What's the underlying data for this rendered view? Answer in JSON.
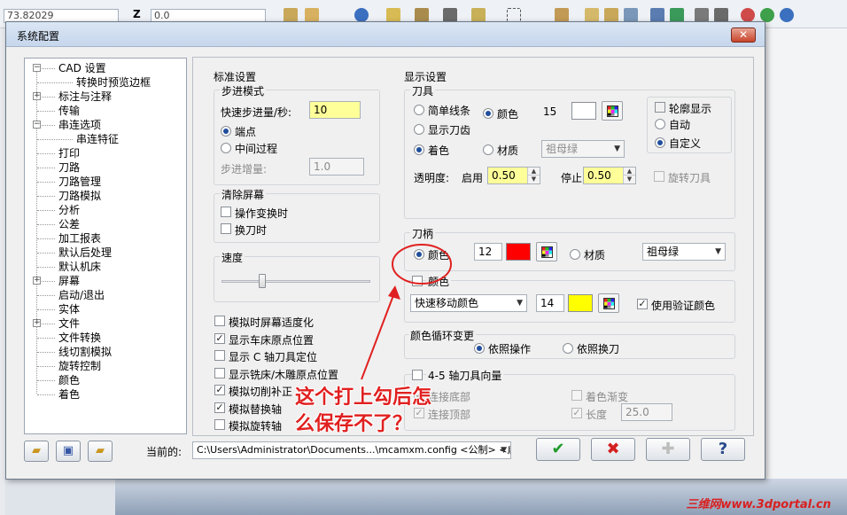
{
  "bg_toolbar": {
    "coord_value": "73.82029",
    "z_label": "Z",
    "z_value": "0.0"
  },
  "watermark": "三维网www.3dportal.cn",
  "dialog": {
    "title": "系统配置",
    "close_label": "✕"
  },
  "tree": {
    "items": [
      {
        "label": "CAD 设置",
        "expander": "−"
      },
      {
        "label": "转换时预览边框"
      },
      {
        "label": "标注与注释",
        "expander": "+"
      },
      {
        "label": "传输"
      },
      {
        "label": "串连选项",
        "expander": "−"
      },
      {
        "label": "串连特征"
      },
      {
        "label": "打印"
      },
      {
        "label": "刀路"
      },
      {
        "label": "刀路管理"
      },
      {
        "label": "刀路模拟"
      },
      {
        "label": "分析"
      },
      {
        "label": "公差"
      },
      {
        "label": "加工报表"
      },
      {
        "label": "默认后处理"
      },
      {
        "label": "默认机床"
      },
      {
        "label": "屏幕",
        "expander": "+"
      },
      {
        "label": "启动/退出"
      },
      {
        "label": "实体"
      },
      {
        "label": "文件",
        "expander": "+"
      },
      {
        "label": "文件转换"
      },
      {
        "label": "线切割模拟"
      },
      {
        "label": "旋转控制"
      },
      {
        "label": "颜色"
      },
      {
        "label": "着色"
      }
    ]
  },
  "standard": {
    "title": "标准设置",
    "step_mode": {
      "title": "步进模式",
      "speed_label": "快速步进量/秒:",
      "speed_value": "10",
      "endpoint_label": "端点",
      "midprocess_label": "中间过程",
      "increment_label": "步进增量:",
      "increment_value": "1.0"
    },
    "clear_screen": {
      "title": "清除屏幕",
      "on_op_change": "操作变换时",
      "on_tool_change": "换刀时"
    },
    "speed": {
      "title": "速度"
    },
    "options": [
      {
        "label": "模拟时屏幕适度化",
        "checked": false
      },
      {
        "label": "显示车床原点位置",
        "checked": true
      },
      {
        "label": "显示 C 轴刀具定位",
        "checked": false
      },
      {
        "label": "显示铣床/木雕原点位置",
        "checked": false
      },
      {
        "label": "模拟切削补正",
        "checked": true
      },
      {
        "label": "模拟替换轴",
        "checked": true
      },
      {
        "label": "模拟旋转轴",
        "checked": false
      }
    ]
  },
  "display": {
    "title": "显示设置",
    "tool": {
      "title": "刀具",
      "simple_lines": "简单线条",
      "show_flutes": "显示刀齿",
      "shaded": "着色",
      "color_label": "颜色",
      "color_number": "15",
      "material_label": "材质",
      "material_value": "祖母绿",
      "outline_label": "轮廓显示",
      "auto_label": "自动",
      "custom_label": "自定义",
      "transparency_label": "透明度:",
      "enable_label": "启用",
      "enable_value": "0.50",
      "stop_label": "停止",
      "stop_value": "0.50",
      "rotate_tool_label": "旋转刀具",
      "swatch_color": "#ffffff"
    },
    "holder": {
      "title": "刀柄",
      "color_label": "颜色",
      "color_number": "12",
      "swatch_color": "#ff0000",
      "material_label": "材质",
      "material_value": "祖母绿"
    },
    "color": {
      "checkbox_label": "颜色",
      "mode_value": "快速移动颜色",
      "color_number": "14",
      "swatch_color": "#ffff00",
      "use_verify_label": "使用验证颜色"
    },
    "cycle": {
      "title": "颜色循环变更",
      "by_operation": "依照操作",
      "by_tool_change": "依照换刀"
    },
    "axis45": {
      "title": "4-5 轴刀具向量",
      "connect_bottom": "连接底部",
      "connect_tip": "连接顶部",
      "shade_gradient": "着色渐变",
      "length_label": "长度",
      "length_value": "25.0"
    }
  },
  "footer": {
    "current_label": "当前的:",
    "config_path": "C:\\Users\\Administrator\\Documents...\\mcamxm.config <公制> <启动>",
    "ok_symbol": "✔",
    "cancel_symbol": "✖",
    "add_symbol": "✚",
    "help_symbol": "?"
  },
  "annotation": {
    "line1": "这个打上勾后怎",
    "line2": "么保存不了？"
  },
  "colors": {
    "accent": "#1f4e9c",
    "annotation": "#e02020",
    "highlight_yellow": "#ffff99"
  }
}
